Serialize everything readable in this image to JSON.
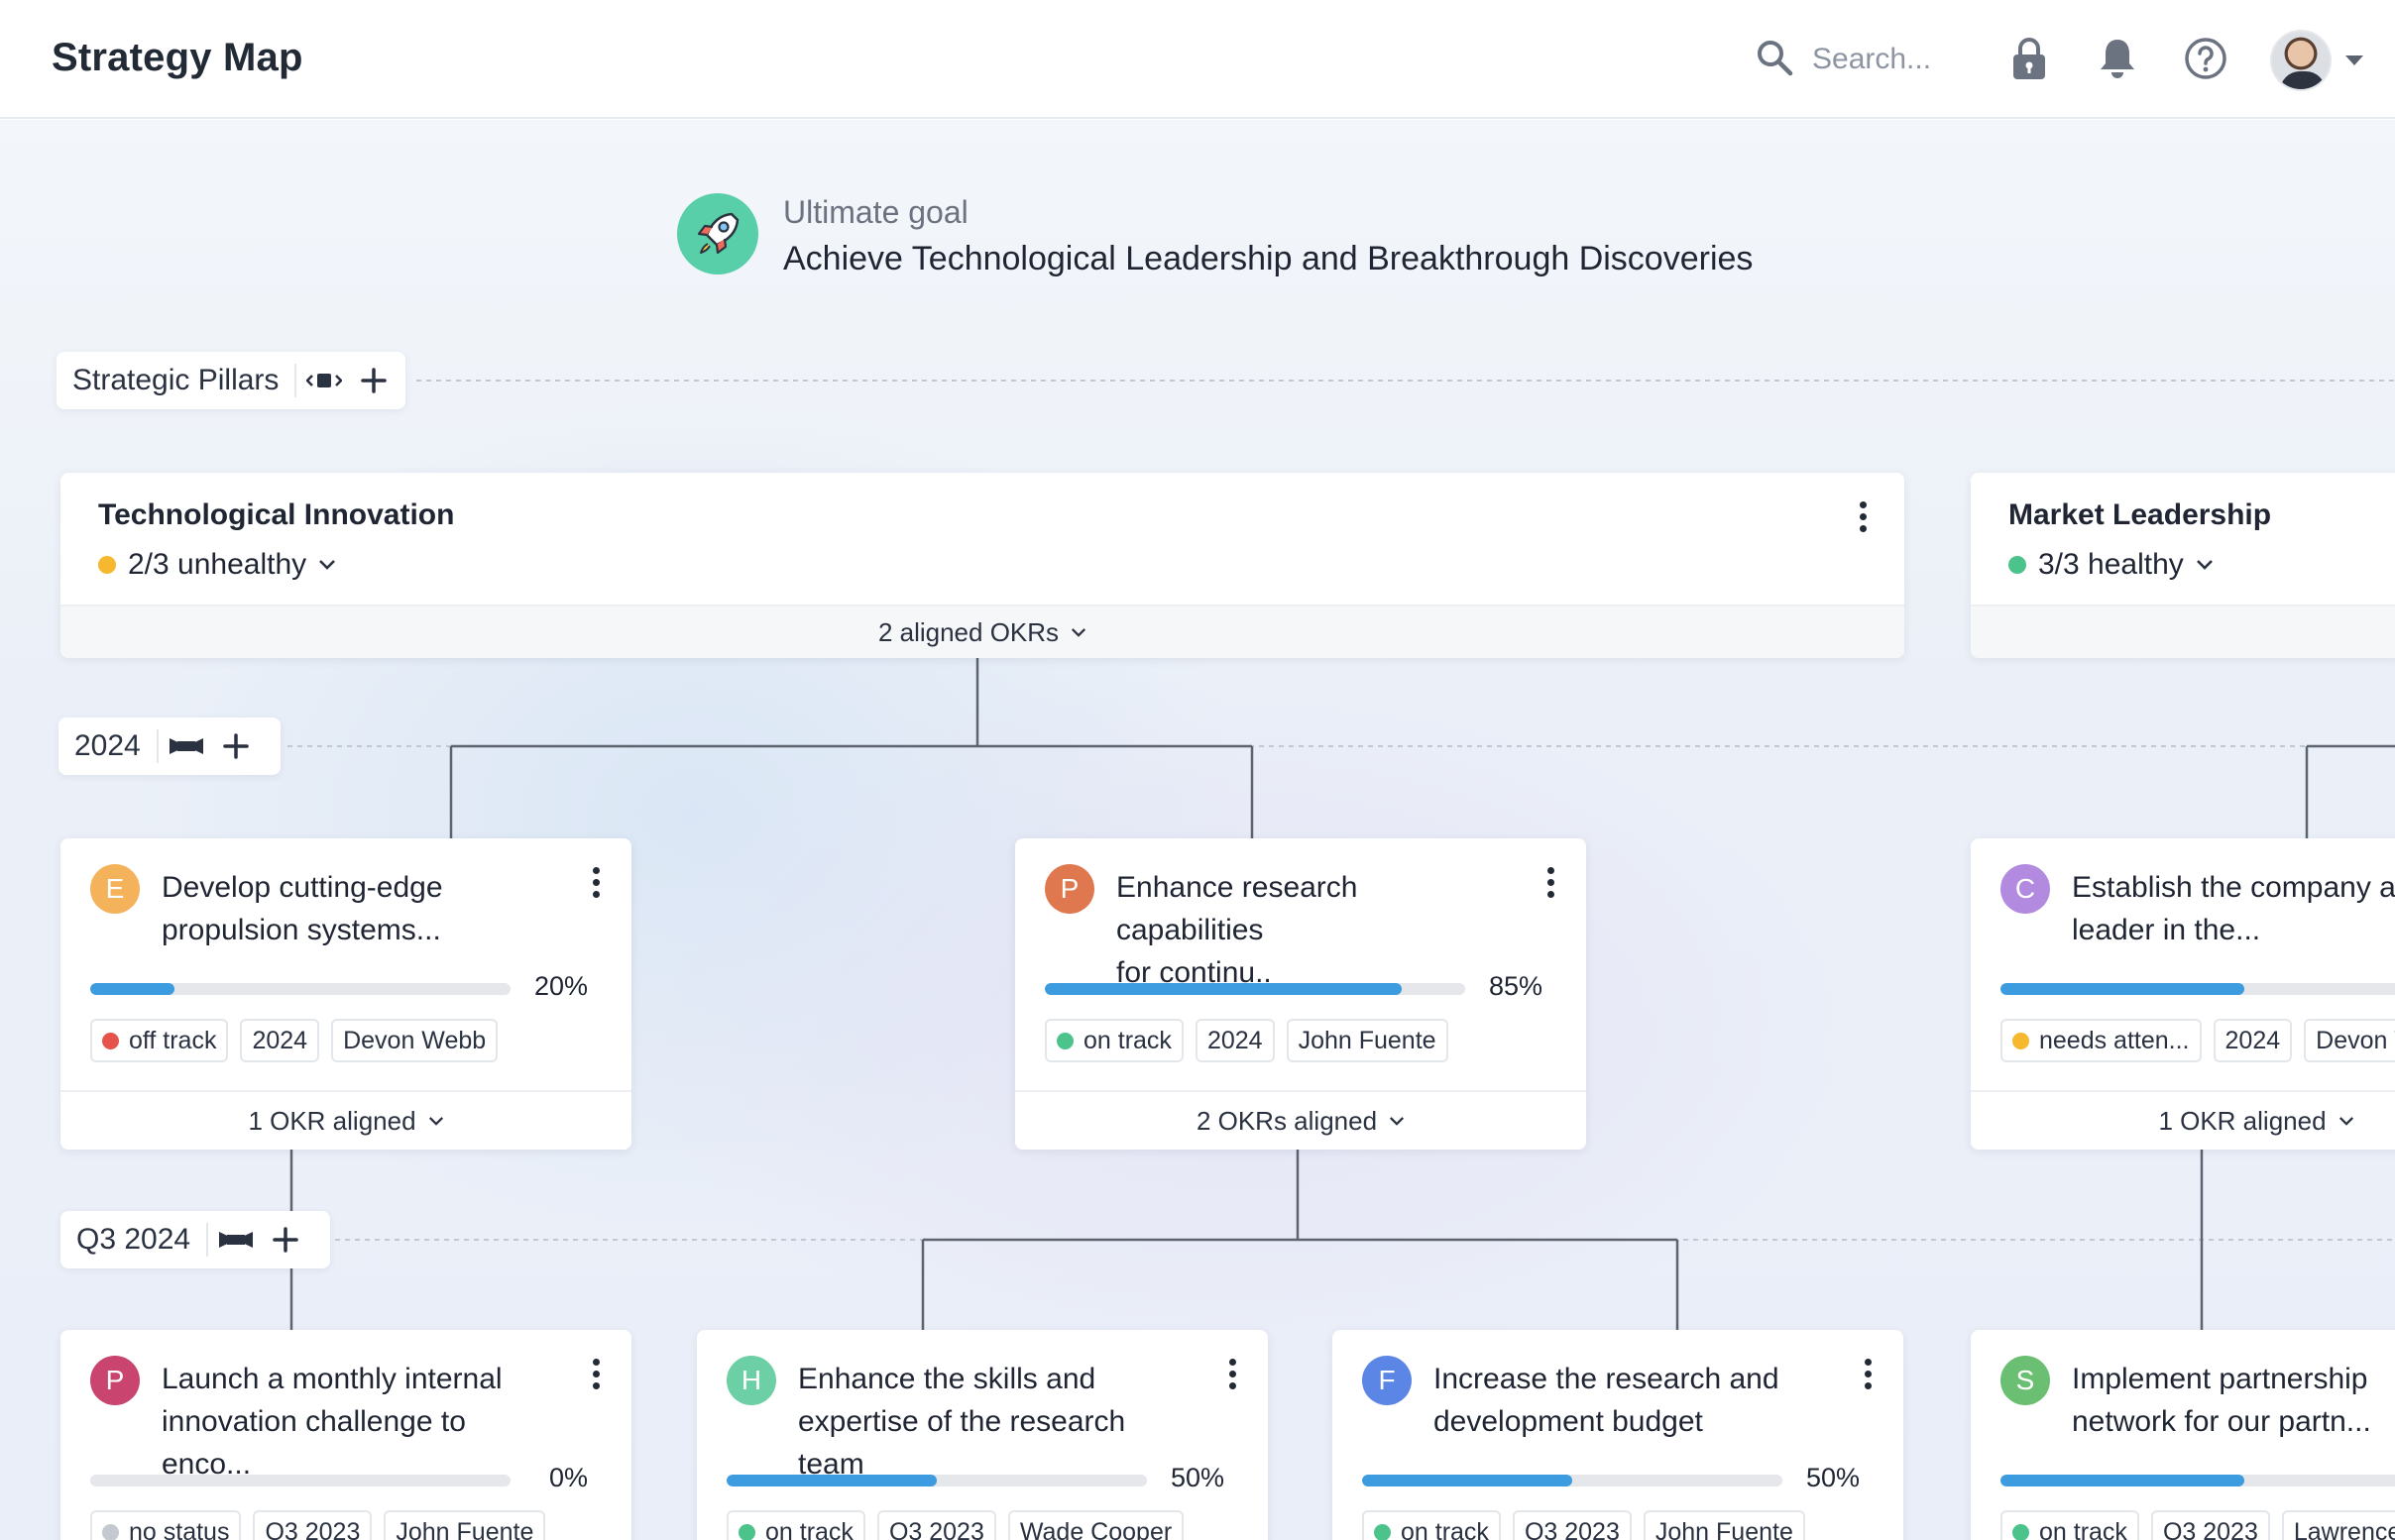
{
  "header": {
    "title": "Strategy Map",
    "search_placeholder": "Search...",
    "icons": [
      "search-icon",
      "lock-icon",
      "bell-icon",
      "help-icon"
    ]
  },
  "goal": {
    "label": "Ultimate goal",
    "title": "Achieve Technological Leadership and Breakthrough Discoveries"
  },
  "rows": {
    "pillars_label": "Strategic Pillars",
    "year_label": "2024",
    "quarter_label": "Q3 2024"
  },
  "pillars": [
    {
      "title": "Technological Innovation",
      "health": "2/3 unhealthy",
      "health_color": "#f5b82e",
      "okrs": "2 aligned OKRs"
    },
    {
      "title": "Market Leadership",
      "health": "3/3 healthy",
      "health_color": "#4cc38a",
      "okrs": ""
    }
  ],
  "colors": {
    "off_track": "#e5534b",
    "on_track": "#4cc38a",
    "needs_attention": "#f5b82e",
    "no_status": "#c4c8cf",
    "progress": "#3d9be0"
  },
  "okrs_2024": [
    {
      "initial": "E",
      "avatar_color": "#f4b25a",
      "title_line1": "Develop cutting-edge",
      "title_line2": "propulsion systems...",
      "progress": 20,
      "pct": "20%",
      "status": "off track",
      "status_color": "#e5534b",
      "period": "2024",
      "owner": "Devon Webb",
      "aligned": "1 OKR aligned"
    },
    {
      "initial": "P",
      "avatar_color": "#e0784f",
      "title_line1": "Enhance research capabilities",
      "title_line2": "for continu..",
      "progress": 85,
      "pct": "85%",
      "status": "on track",
      "status_color": "#4cc38a",
      "period": "2024",
      "owner": "John Fuente",
      "aligned": "2 OKRs aligned"
    },
    {
      "initial": "C",
      "avatar_color": "#b28ae0",
      "title_line1": "Establish the company as",
      "title_line2": "leader in the...",
      "progress": 58,
      "pct": "",
      "status": "needs atten...",
      "status_color": "#f5b82e",
      "period": "2024",
      "owner": "Devon V",
      "aligned": "1 OKR aligned"
    }
  ],
  "okrs_q3": [
    {
      "initial": "P",
      "avatar_color": "#c9446e",
      "title_line1": "Launch a monthly internal",
      "title_line2": "innovation challenge to enco...",
      "progress": 0,
      "pct": "0%",
      "status": "no status",
      "status_color": "#c4c8cf",
      "period": "Q3 2023",
      "owner": "John Fuente"
    },
    {
      "initial": "H",
      "avatar_color": "#6dcfa5",
      "title_line1": "Enhance the skills and",
      "title_line2": "expertise of the research team",
      "progress": 50,
      "pct": "50%",
      "status": "on track",
      "status_color": "#4cc38a",
      "period": "Q3 2023",
      "owner": "Wade Cooper"
    },
    {
      "initial": "F",
      "avatar_color": "#5b86e6",
      "title_line1": "Increase the research and",
      "title_line2": "development budget",
      "progress": 50,
      "pct": "50%",
      "status": "on track",
      "status_color": "#4cc38a",
      "period": "Q3 2023",
      "owner": "John Fuente"
    },
    {
      "initial": "S",
      "avatar_color": "#6bbf73",
      "title_line1": "Implement partnership",
      "title_line2": "network for our partn...",
      "progress": 58,
      "pct": "",
      "status": "on track",
      "status_color": "#4cc38a",
      "period": "Q3 2023",
      "owner": "Lawrence"
    }
  ]
}
